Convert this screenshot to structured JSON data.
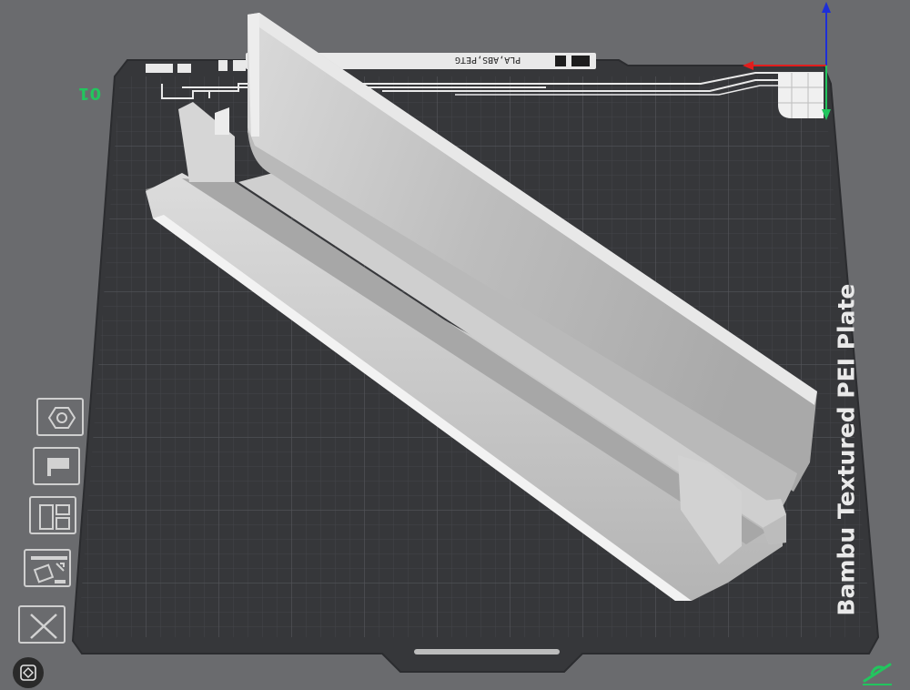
{
  "plate": {
    "number": "01",
    "name": "Bambu Textured PEI Plate",
    "filaments": "PLA,ABS,PETG"
  },
  "toolbar": {
    "buttons": [
      {
        "name": "filament-icon"
      },
      {
        "name": "extruder-icon"
      },
      {
        "name": "arrange-icon"
      },
      {
        "name": "auto-orient-icon"
      },
      {
        "name": "close-icon"
      }
    ]
  },
  "colors": {
    "background": "#6a6b6e",
    "plate": "#36373a",
    "plate_grid": "#4b4c50",
    "model": "#c9c9c9",
    "accent_green": "#22c55e",
    "axis_x": "#e11d1d",
    "axis_y": "#22c55e",
    "axis_z": "#1d2fd8"
  }
}
